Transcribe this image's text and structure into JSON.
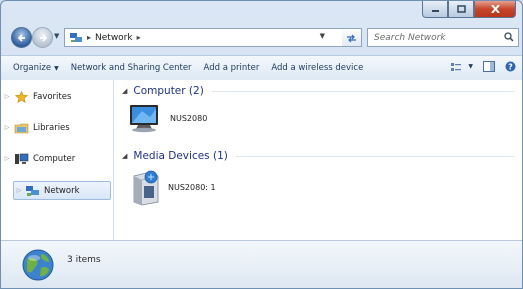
{
  "address": {
    "crumbs": [
      "Network"
    ],
    "separator": "▸"
  },
  "search": {
    "placeholder": "Search Network"
  },
  "toolbar": {
    "organize_label": "Organize",
    "network_sharing_label": "Network and Sharing Center",
    "add_printer_label": "Add a printer",
    "add_wireless_label": "Add a wireless device"
  },
  "sidebar": {
    "items": [
      {
        "label": "Favorites",
        "icon": "star-icon"
      },
      {
        "label": "Libraries",
        "icon": "libraries-icon"
      },
      {
        "label": "Computer",
        "icon": "computer-icon"
      },
      {
        "label": "Network",
        "icon": "network-icon",
        "selected": true
      }
    ]
  },
  "groups": [
    {
      "title": "Computer (2)",
      "items": [
        {
          "label": "NUS2080",
          "icon": "computer-icon"
        }
      ]
    },
    {
      "title": "Media Devices (1)",
      "items": [
        {
          "label": "NUS2080: 1",
          "icon": "media-device-icon"
        }
      ]
    }
  ],
  "details": {
    "count_text": "3 items"
  },
  "colors": {
    "accent": "#1e3287",
    "selection": "#d8e7f8",
    "close": "#c7452b"
  }
}
